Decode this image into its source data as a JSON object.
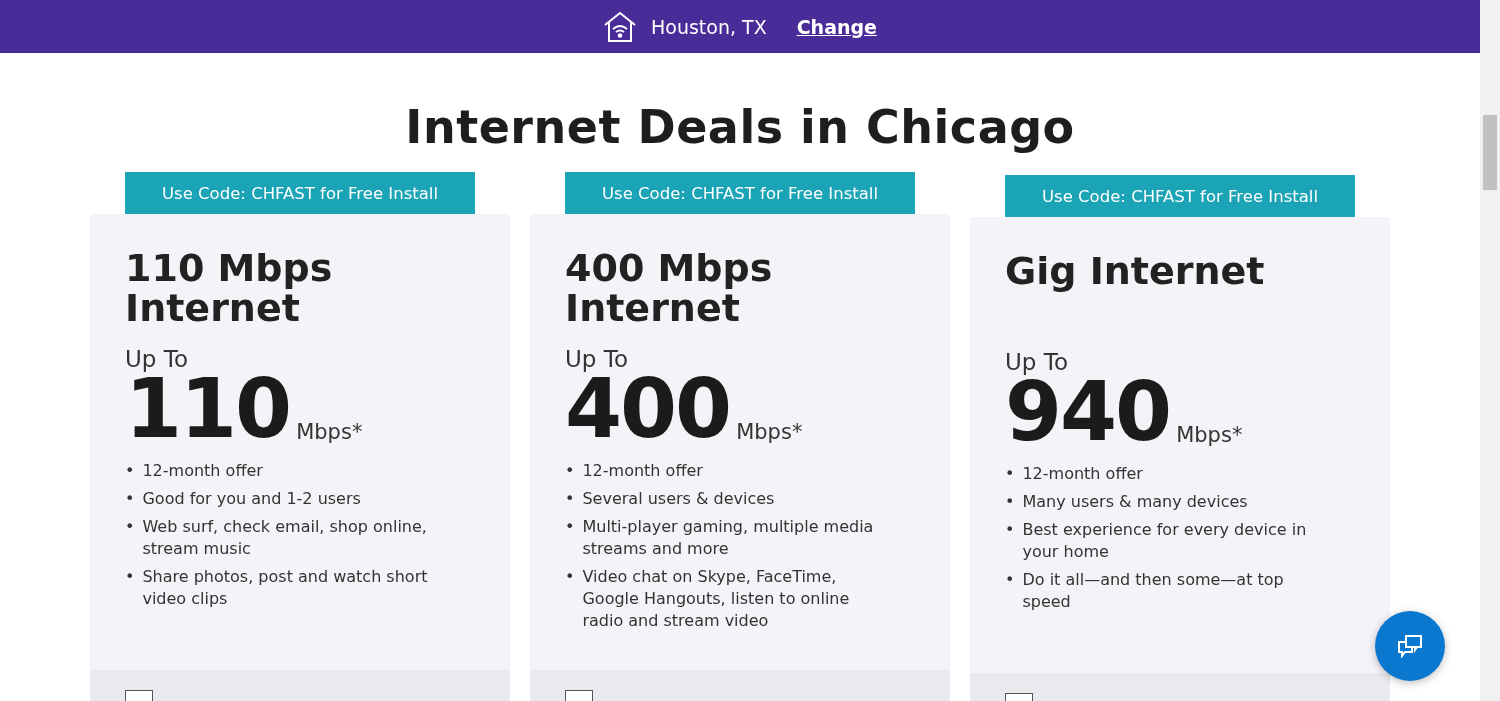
{
  "location_bar": {
    "city": "Houston, TX",
    "link": "Change"
  },
  "title": "Internet Deals in Chicago",
  "plans": [
    {
      "promo": "Use Code: CHFAST for Free Install",
      "name": "110 Mbps Internet",
      "up_to": "Up To",
      "speed": "110",
      "unit": "Mbps*",
      "bullet": "•",
      "features": [
        "12-month offer",
        "Good for you and 1-2 users",
        "Web surf, check email, shop online, stream music",
        "Share photos, post and watch short video clips"
      ],
      "compare_checked": false
    },
    {
      "promo": "Use Code: CHFAST for Free Install",
      "name": "400 Mbps Internet",
      "up_to": "Up To",
      "speed": "400",
      "unit": "Mbps*",
      "bullet": "•",
      "features": [
        "12-month offer",
        "Several users & devices",
        "Multi-player gaming, multiple media streams and more",
        "Video chat on Skype, FaceTime, Google Hangouts, listen to online radio and stream video"
      ],
      "compare_checked": false
    },
    {
      "promo": "Use Code: CHFAST for Free Install",
      "name": "Gig Internet",
      "up_to": "Up To",
      "speed": "940",
      "unit": "Mbps*",
      "bullet": "•",
      "features": [
        "12-month offer",
        "Many users & many devices",
        "Best experience for every device in your home",
        "Do it all—and then some—at top speed"
      ],
      "compare_checked": false
    }
  ]
}
